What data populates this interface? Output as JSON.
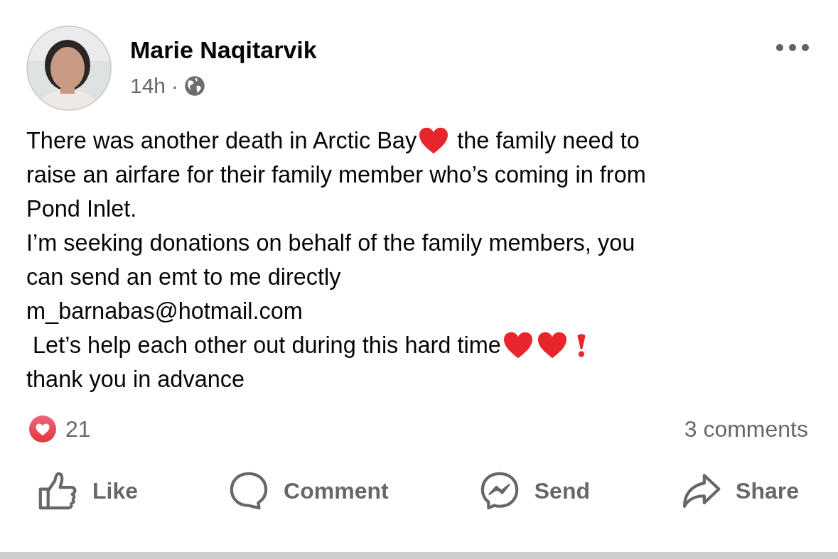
{
  "author": {
    "name": "Marie Naqitarvik",
    "time": "14h",
    "separator": "·"
  },
  "body": [
    {
      "parts": [
        {
          "kind": "text",
          "text": "There was another death in Arctic Bay"
        },
        {
          "kind": "heart"
        },
        {
          "kind": "text",
          "text": " the family need to"
        }
      ]
    },
    {
      "parts": [
        {
          "kind": "text",
          "text": "raise an airfare for their family member who’s coming in from"
        }
      ]
    },
    {
      "parts": [
        {
          "kind": "text",
          "text": "Pond Inlet."
        }
      ]
    },
    {
      "parts": [
        {
          "kind": "text",
          "text": "I’m seeking donations on behalf of the family members, you"
        }
      ]
    },
    {
      "parts": [
        {
          "kind": "text",
          "text": "can send an emt to me directly"
        }
      ]
    },
    {
      "parts": [
        {
          "kind": "text",
          "text": "m_barnabas@hotmail.com"
        }
      ]
    },
    {
      "parts": [
        {
          "kind": "text",
          "text": " Let’s help each other out during this hard time"
        },
        {
          "kind": "heart"
        },
        {
          "kind": "heart"
        },
        {
          "kind": "exclamation"
        }
      ]
    },
    {
      "parts": [
        {
          "kind": "text",
          "text": "thank you in advance"
        }
      ]
    }
  ],
  "reactions": {
    "count": "21",
    "comments": "3 comments"
  },
  "actions": [
    {
      "kind": "like",
      "label": "Like"
    },
    {
      "kind": "comment",
      "label": "Comment"
    },
    {
      "kind": "send",
      "label": "Send"
    },
    {
      "kind": "share",
      "label": "Share"
    }
  ]
}
